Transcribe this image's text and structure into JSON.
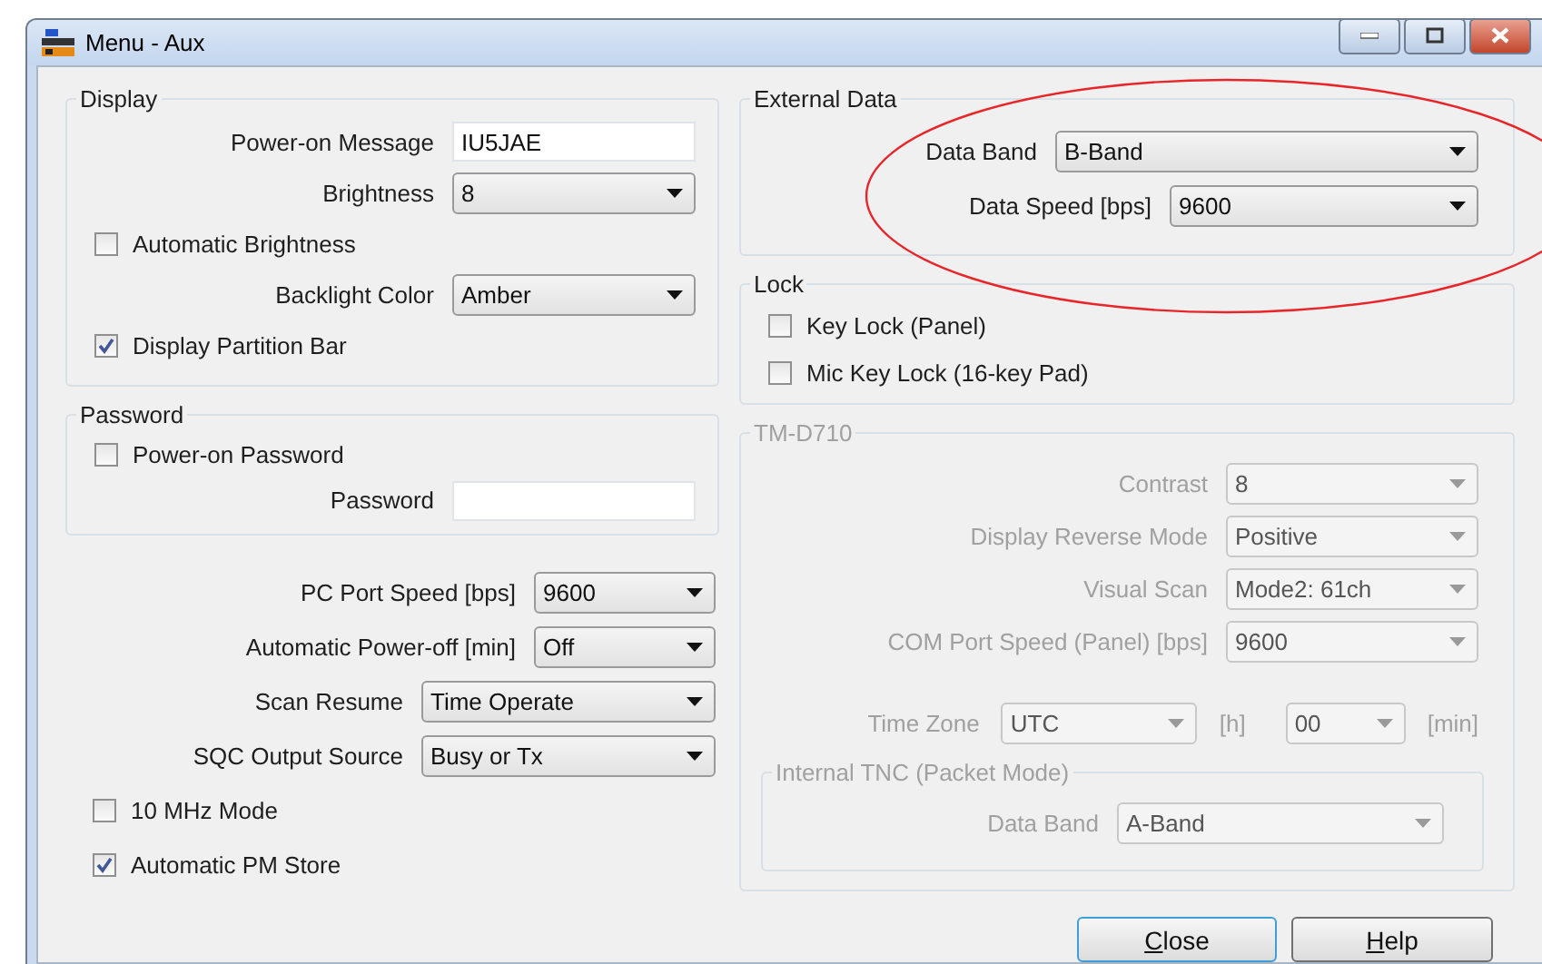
{
  "window": {
    "title": "Menu - Aux"
  },
  "display": {
    "title": "Display",
    "rows": [
      {
        "kind": "text",
        "label": "Power-on Message",
        "value": "IU5JAE"
      },
      {
        "kind": "select",
        "label": "Brightness",
        "value": "8"
      },
      {
        "kind": "checkbox",
        "label": "Automatic Brightness",
        "checked": false
      },
      {
        "kind": "select",
        "label": "Backlight Color",
        "value": "Amber"
      },
      {
        "kind": "checkbox",
        "label": "Display Partition Bar",
        "checked": true
      }
    ]
  },
  "password": {
    "title": "Password",
    "rows": [
      {
        "kind": "checkbox",
        "label": "Power-on Password",
        "checked": false
      },
      {
        "kind": "text",
        "label": "Password"
      }
    ]
  },
  "general": {
    "rows": [
      {
        "kind": "select",
        "label": "PC Port Speed [bps]",
        "value": "9600"
      },
      {
        "kind": "select",
        "label": "Automatic Power-off [min]",
        "value": "Off"
      },
      {
        "kind": "select",
        "label": "Scan Resume",
        "value": "Time Operate"
      },
      {
        "kind": "select",
        "label": "SQC Output Source",
        "value": "Busy or Tx"
      },
      {
        "kind": "checkbox",
        "label": "10 MHz Mode",
        "checked": false
      },
      {
        "kind": "checkbox",
        "label": "Automatic PM Store",
        "checked": true
      }
    ]
  },
  "external_data": {
    "title": "External Data",
    "rows": [
      {
        "kind": "select",
        "label": "Data Band",
        "value": "B-Band"
      },
      {
        "kind": "select",
        "label": "Data Speed [bps]",
        "value": "9600"
      }
    ]
  },
  "lock": {
    "title": "Lock",
    "rows": [
      {
        "kind": "checkbox",
        "label": "Key Lock (Panel)",
        "checked": false
      },
      {
        "kind": "checkbox",
        "label": "Mic Key Lock (16-key Pad)",
        "checked": false
      }
    ]
  },
  "tm_d710": {
    "title": "TM-D710",
    "disabled": true,
    "rows": [
      {
        "kind": "select",
        "label": "Contrast",
        "value": "8"
      },
      {
        "kind": "select",
        "label": "Display Reverse Mode",
        "value": "Positive"
      },
      {
        "kind": "select",
        "label": "Visual Scan",
        "value": "Mode2: 61ch"
      },
      {
        "kind": "select",
        "label": "COM Port Speed (Panel) [bps]",
        "value": "9600"
      },
      {
        "kind": "timezone",
        "label": "Time Zone",
        "hours": "UTC",
        "hours_unit": "[h]",
        "minutes": "00",
        "minutes_unit": "[min]"
      }
    ],
    "internal_tnc": {
      "title": "Internal TNC (Packet Mode)",
      "rows": [
        {
          "kind": "select",
          "label": "Data Band",
          "value": "A-Band"
        }
      ]
    }
  },
  "buttons": [
    {
      "label": "Close",
      "default": true
    },
    {
      "label": "Help",
      "default": false
    }
  ],
  "annotation": {
    "kind": "ellipse",
    "color": "#e8262a"
  }
}
